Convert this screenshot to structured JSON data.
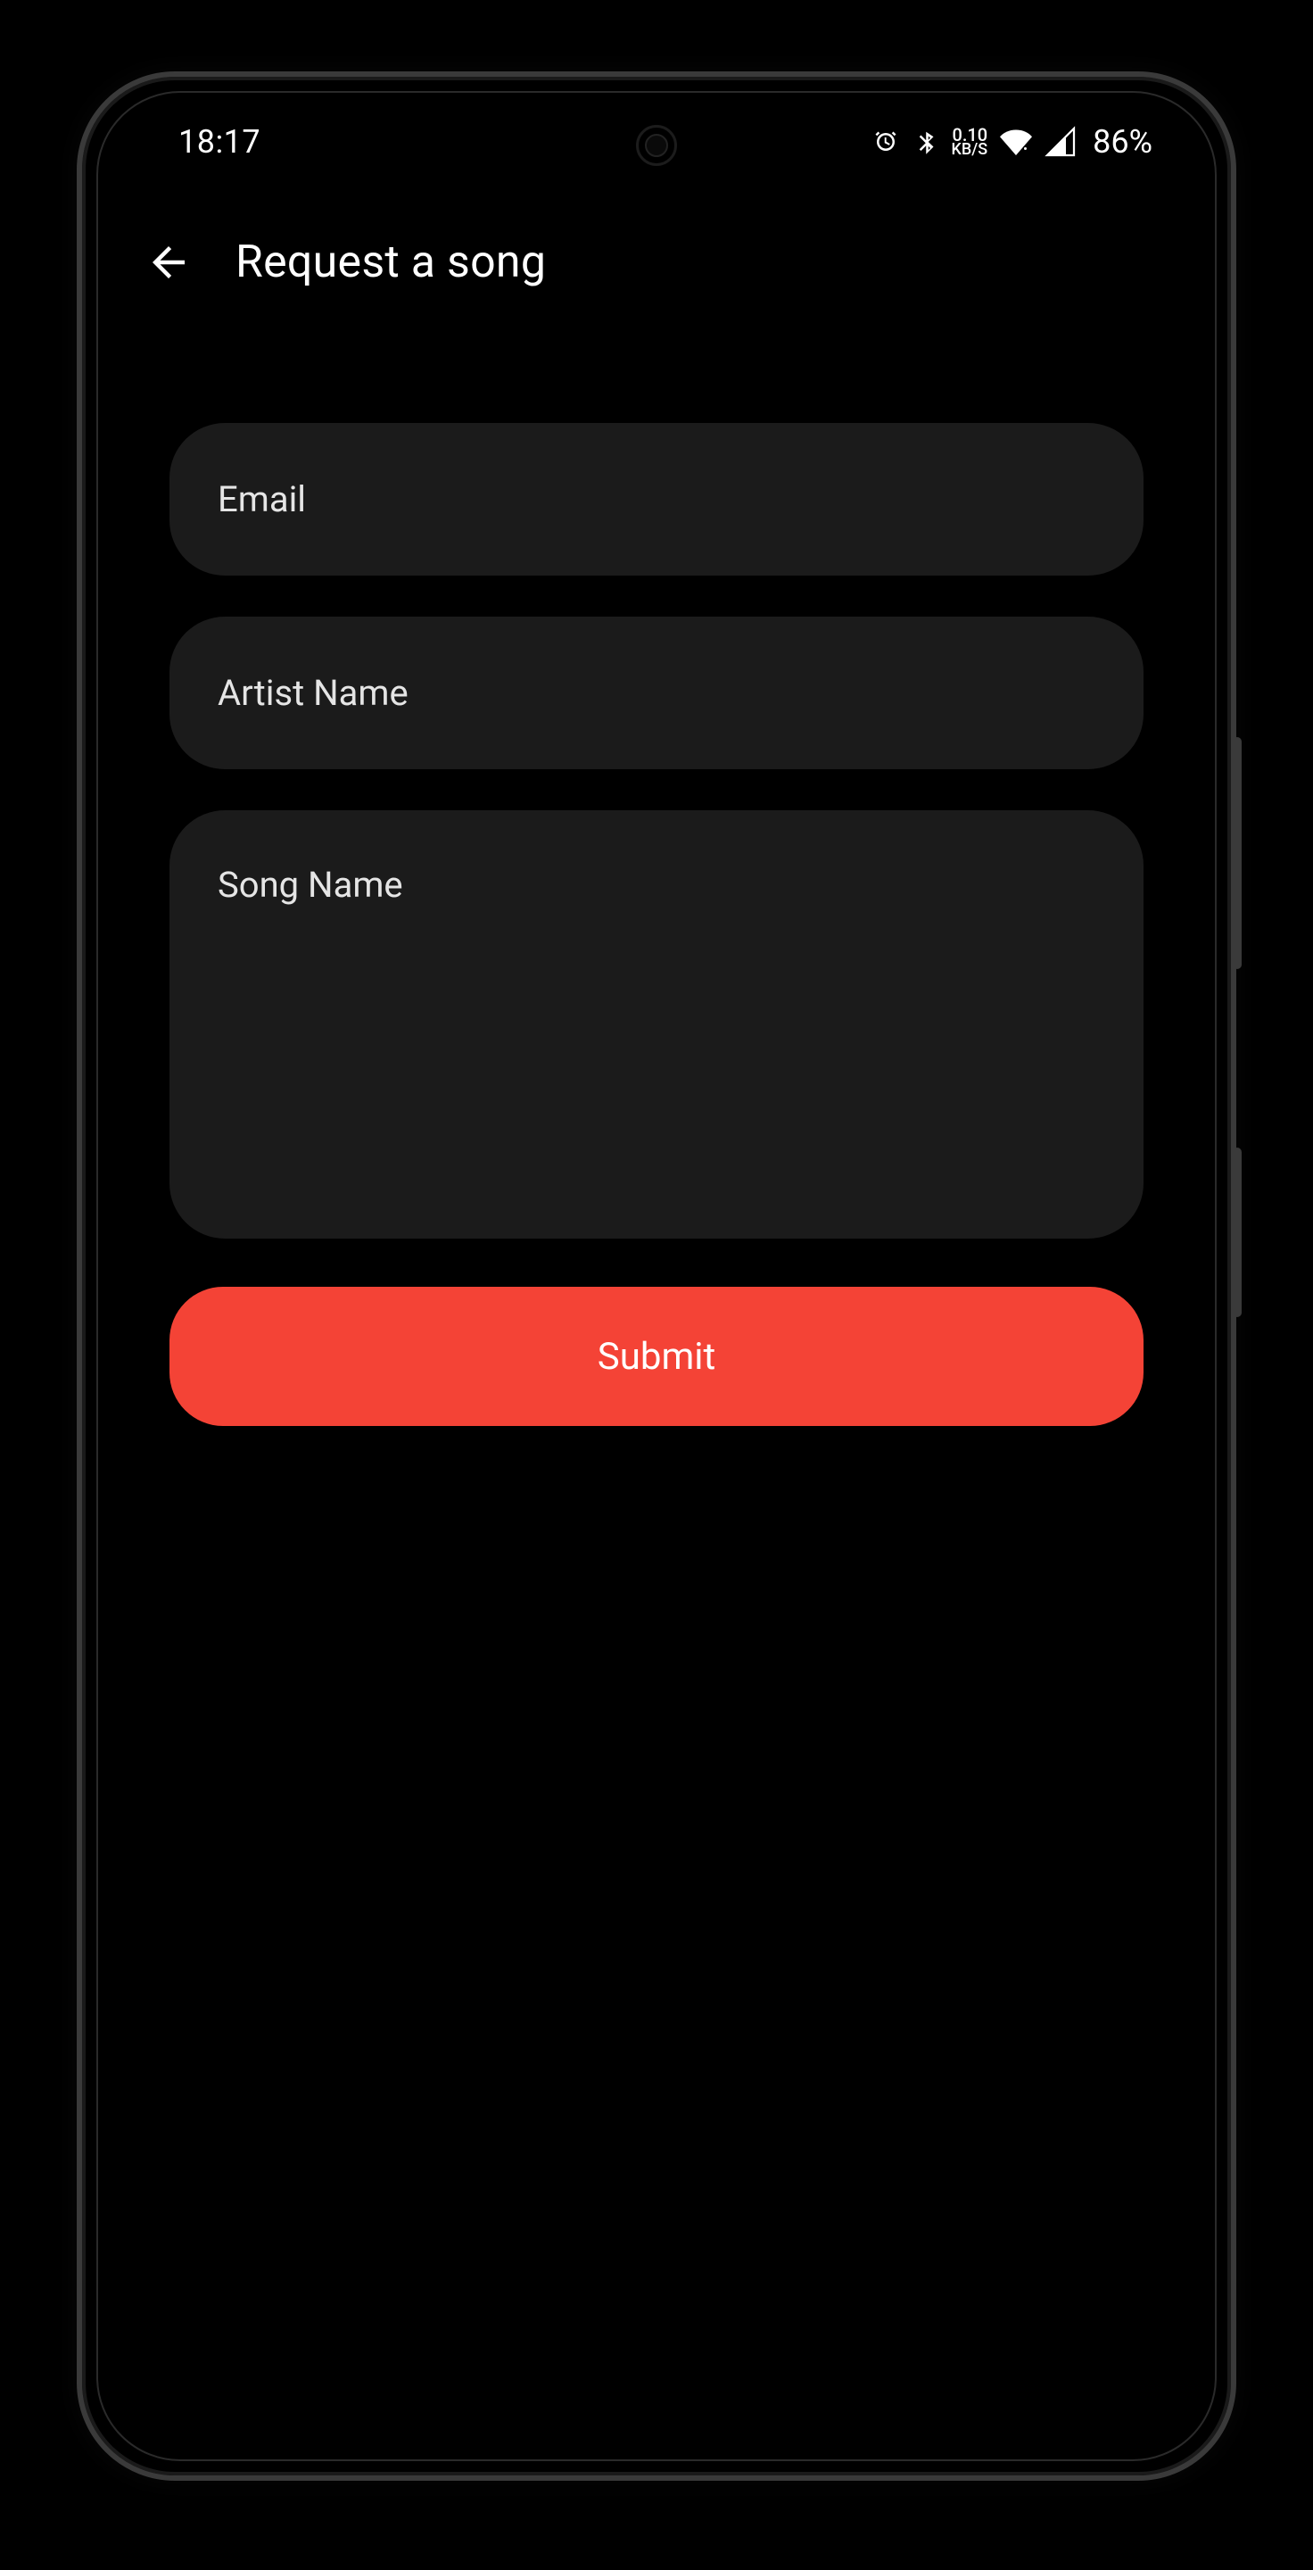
{
  "status_bar": {
    "time": "18:17",
    "network_speed_value": "0.10",
    "network_speed_unit": "KB/S",
    "battery_percent": "86%"
  },
  "app_bar": {
    "title": "Request a song"
  },
  "form": {
    "email_placeholder": "Email",
    "artist_placeholder": "Artist Name",
    "song_placeholder": "Song Name",
    "submit_label": "Submit"
  }
}
